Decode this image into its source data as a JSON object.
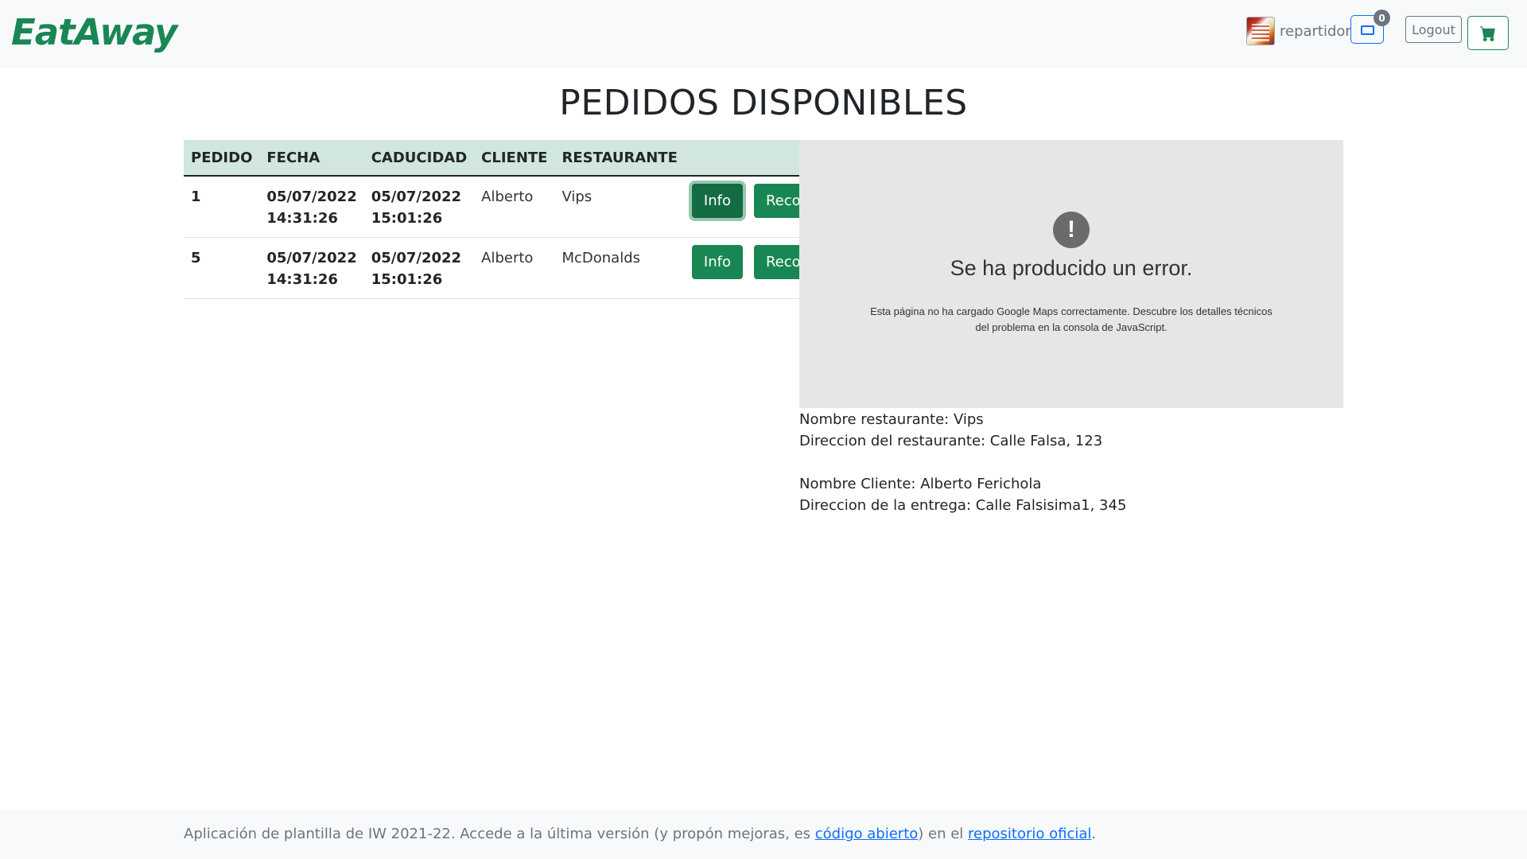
{
  "header": {
    "brand": "EatAway",
    "username": "repartidor",
    "messages_count": "0",
    "logout_label": "Logout",
    "colors": {
      "brand": "#198754",
      "messages": "#0d6efd",
      "cart": "#198754"
    },
    "icons": {
      "messages": "envelope-icon",
      "cart": "cart-icon"
    }
  },
  "page": {
    "title": "PEDIDOS DISPONIBLES"
  },
  "table": {
    "columns": [
      "PEDIDO",
      "FECHA",
      "CADUCIDAD",
      "CLIENTE",
      "RESTAURANTE"
    ],
    "rows": [
      {
        "pedido": "1",
        "fecha_date": "05/07/2022",
        "fecha_time": "14:31:26",
        "caducidad_date": "05/07/2022",
        "caducidad_time": "15:01:26",
        "cliente": "Alberto",
        "restaurante": "Vips",
        "info_label": "Info",
        "recoger_label": "Recoger"
      },
      {
        "pedido": "5",
        "fecha_date": "05/07/2022",
        "fecha_time": "14:31:26",
        "caducidad_date": "05/07/2022",
        "caducidad_time": "15:01:26",
        "cliente": "Alberto",
        "restaurante": "McDonalds",
        "info_label": "Info",
        "recoger_label": "Recoger"
      }
    ]
  },
  "map": {
    "error_icon": "!",
    "error_title": "Se ha producido un error.",
    "error_text_line1": "Esta página no ha cargado Google Maps correctamente. Descubre los detalles técnicos",
    "error_text_line2": "del problema en la consola de JavaScript."
  },
  "info": {
    "restaurant_name": "Nombre restaurante: Vips",
    "restaurant_address": "Direccion del restaurante: Calle Falsa, 123",
    "client_name": "Nombre Cliente: Alberto Ferichola",
    "delivery_address": "Direccion de la entrega: Calle Falsisima1, 345"
  },
  "footer": {
    "text_before": "Aplicación de plantilla de IW 2021-22. Accede a la última versión (y propón mejoras, es ",
    "link1": "código abierto",
    "text_middle": ") en el ",
    "link2": "repositorio oficial",
    "text_after": "."
  }
}
